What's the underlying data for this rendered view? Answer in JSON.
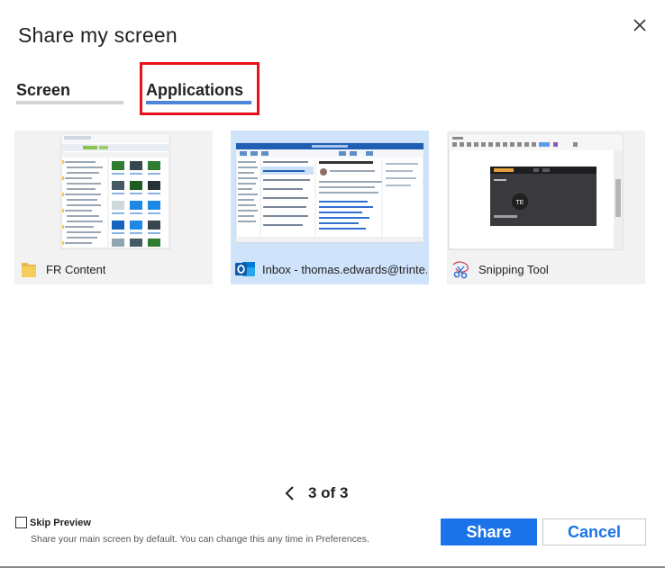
{
  "dialog": {
    "title": "Share my screen",
    "close_icon": "close-icon"
  },
  "tabs": [
    {
      "label": "Screen",
      "selected": false
    },
    {
      "label": "Applications",
      "selected": true
    }
  ],
  "highlight_color": "#e8121a",
  "accent_color": "#1a73e8",
  "apps": [
    {
      "label": "FR Content",
      "icon": "folder-icon",
      "selected": false
    },
    {
      "label": "Inbox - thomas.edwards@trinte...",
      "icon": "outlook-icon",
      "selected": true
    },
    {
      "label": "Snipping Tool",
      "icon": "snipping-tool-icon",
      "selected": false
    }
  ],
  "preview_avatar": "TE",
  "pager": {
    "text": "3 of 3",
    "prev_icon": "chevron-left-icon"
  },
  "skip_preview": {
    "label": "Skip Preview",
    "checked": false,
    "description": "Share your main screen by default. You can change this any time in Preferences."
  },
  "buttons": {
    "share": "Share",
    "cancel": "Cancel"
  }
}
